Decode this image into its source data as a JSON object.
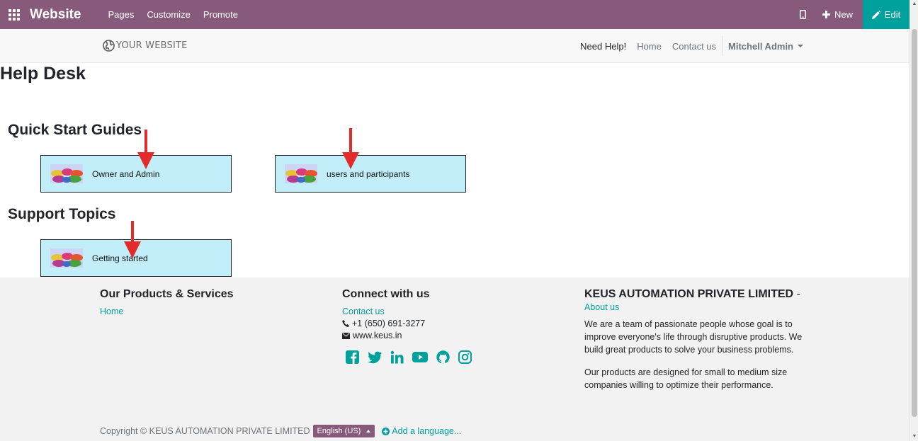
{
  "topbar": {
    "app_name": "Website",
    "menu": [
      "Pages",
      "Customize",
      "Promote"
    ],
    "new_label": "New",
    "edit_label": "Edit"
  },
  "site_header": {
    "logo_text": "YOUR WEBSITE",
    "nav": [
      "Need Help!",
      "Home",
      "Contact us"
    ],
    "user": "Mitchell Admin"
  },
  "main": {
    "title": "Help Desk",
    "sections": [
      {
        "title": "Quick Start Guides",
        "cards": [
          "Owner and Admin",
          "users and participants"
        ]
      },
      {
        "title": "Support Topics",
        "cards": [
          "Getting started"
        ]
      }
    ]
  },
  "footer": {
    "col1": {
      "title": "Our Products & Services",
      "links": [
        "Home"
      ]
    },
    "col2": {
      "title": "Connect with us",
      "link": "Contact us",
      "phone": "+1 (650) 691-3277",
      "email": "www.keus.in"
    },
    "col3": {
      "title": "KEUS AUTOMATION PRIVATE LIMITED",
      "title_suffix": "-",
      "link": "About us",
      "para1": "We are a team of passionate people whose goal is to improve everyone's life through disruptive products. We build great products to solve your business problems.",
      "para2": "Our products are designed for small to medium size companies willing to optimize their performance."
    },
    "copyright": "Copyright © KEUS AUTOMATION PRIVATE LIMITED",
    "language": "English (US)",
    "add_language": "Add a language..."
  },
  "colors": {
    "odoo_purple": "#875a7b",
    "teal": "#00a09d",
    "card_bg": "#c1eef8",
    "arrow_red": "#e32b2b"
  },
  "icons": {
    "apps": "apps-grid-icon",
    "mobile": "mobile-icon",
    "new": "plus-icon",
    "edit": "pencil-icon",
    "globe": "globe-icon",
    "social": [
      "facebook-icon",
      "twitter-icon",
      "linkedin-icon",
      "youtube-icon",
      "github-icon",
      "instagram-icon"
    ]
  }
}
